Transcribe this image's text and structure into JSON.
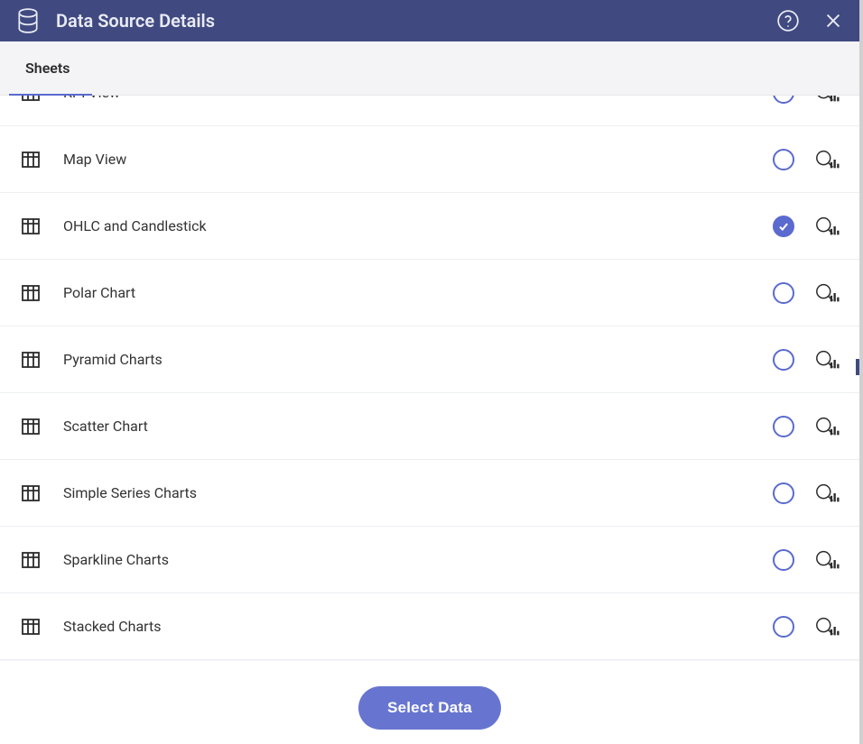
{
  "header": {
    "title": "Data Source Details"
  },
  "tabs": {
    "active": "Sheets"
  },
  "sheets": [
    {
      "label": "KPI View",
      "selected": false
    },
    {
      "label": "Map View",
      "selected": false
    },
    {
      "label": "OHLC and Candlestick",
      "selected": true
    },
    {
      "label": "Polar Chart",
      "selected": false
    },
    {
      "label": "Pyramid Charts",
      "selected": false
    },
    {
      "label": "Scatter Chart",
      "selected": false
    },
    {
      "label": "Simple Series Charts",
      "selected": false
    },
    {
      "label": "Sparkline Charts",
      "selected": false
    },
    {
      "label": "Stacked Charts",
      "selected": false
    }
  ],
  "footer": {
    "select_button": "Select Data"
  },
  "colors": {
    "primary": "#5a6acf",
    "header_bg": "#404a80"
  }
}
